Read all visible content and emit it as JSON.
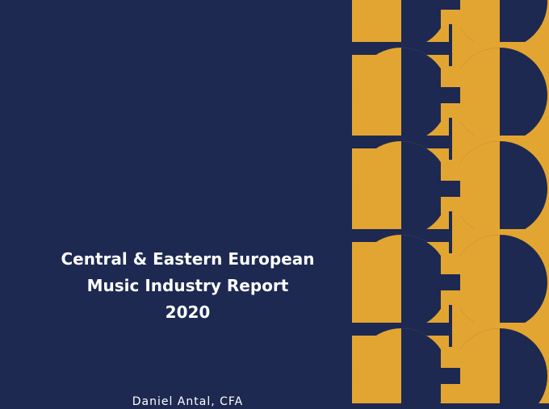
{
  "report": {
    "title_lines": [
      "Central & Eastern European",
      "Music Industry Report",
      "2020"
    ],
    "subtitle": "Daniel Antal, CFA"
  },
  "colors": {
    "background": "#1d2951",
    "accent": "#e3a531",
    "text": "#ffffff"
  },
  "decoration": {
    "pattern_icon": "geometric-circle-pattern-icon"
  }
}
